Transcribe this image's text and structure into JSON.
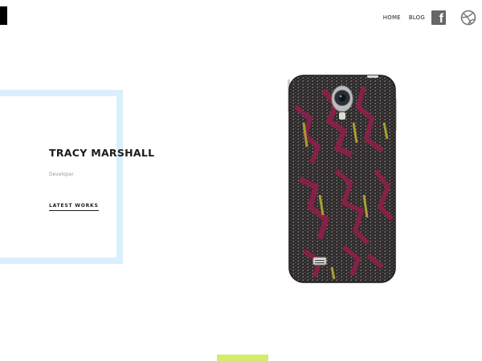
{
  "header": {
    "nav": [
      {
        "label": "HOME"
      },
      {
        "label": "BLOG"
      }
    ],
    "icons": [
      "facebook-icon",
      "dribbble-icon"
    ]
  },
  "hero": {
    "name": "TRACY MARSHALL",
    "role": "Developer",
    "cta_label": "LATEST WORKS"
  },
  "colors": {
    "frame": "#daeffd",
    "accent": "#d6ea6b",
    "phone_pink": "#8e1f4a",
    "phone_olive": "#b2ab33"
  }
}
